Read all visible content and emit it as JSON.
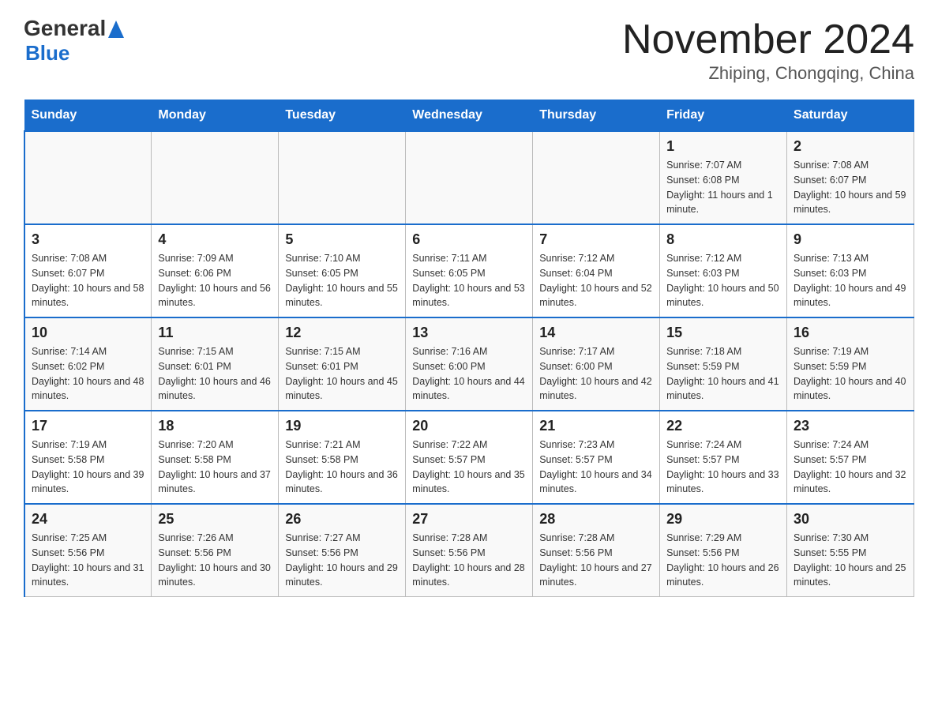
{
  "header": {
    "logo_line1": "General",
    "logo_line2": "Blue",
    "month_title": "November 2024",
    "location": "Zhiping, Chongqing, China"
  },
  "weekdays": [
    "Sunday",
    "Monday",
    "Tuesday",
    "Wednesday",
    "Thursday",
    "Friday",
    "Saturday"
  ],
  "weeks": [
    [
      {
        "day": "",
        "info": ""
      },
      {
        "day": "",
        "info": ""
      },
      {
        "day": "",
        "info": ""
      },
      {
        "day": "",
        "info": ""
      },
      {
        "day": "",
        "info": ""
      },
      {
        "day": "1",
        "info": "Sunrise: 7:07 AM\nSunset: 6:08 PM\nDaylight: 11 hours and 1 minute."
      },
      {
        "day": "2",
        "info": "Sunrise: 7:08 AM\nSunset: 6:07 PM\nDaylight: 10 hours and 59 minutes."
      }
    ],
    [
      {
        "day": "3",
        "info": "Sunrise: 7:08 AM\nSunset: 6:07 PM\nDaylight: 10 hours and 58 minutes."
      },
      {
        "day": "4",
        "info": "Sunrise: 7:09 AM\nSunset: 6:06 PM\nDaylight: 10 hours and 56 minutes."
      },
      {
        "day": "5",
        "info": "Sunrise: 7:10 AM\nSunset: 6:05 PM\nDaylight: 10 hours and 55 minutes."
      },
      {
        "day": "6",
        "info": "Sunrise: 7:11 AM\nSunset: 6:05 PM\nDaylight: 10 hours and 53 minutes."
      },
      {
        "day": "7",
        "info": "Sunrise: 7:12 AM\nSunset: 6:04 PM\nDaylight: 10 hours and 52 minutes."
      },
      {
        "day": "8",
        "info": "Sunrise: 7:12 AM\nSunset: 6:03 PM\nDaylight: 10 hours and 50 minutes."
      },
      {
        "day": "9",
        "info": "Sunrise: 7:13 AM\nSunset: 6:03 PM\nDaylight: 10 hours and 49 minutes."
      }
    ],
    [
      {
        "day": "10",
        "info": "Sunrise: 7:14 AM\nSunset: 6:02 PM\nDaylight: 10 hours and 48 minutes."
      },
      {
        "day": "11",
        "info": "Sunrise: 7:15 AM\nSunset: 6:01 PM\nDaylight: 10 hours and 46 minutes."
      },
      {
        "day": "12",
        "info": "Sunrise: 7:15 AM\nSunset: 6:01 PM\nDaylight: 10 hours and 45 minutes."
      },
      {
        "day": "13",
        "info": "Sunrise: 7:16 AM\nSunset: 6:00 PM\nDaylight: 10 hours and 44 minutes."
      },
      {
        "day": "14",
        "info": "Sunrise: 7:17 AM\nSunset: 6:00 PM\nDaylight: 10 hours and 42 minutes."
      },
      {
        "day": "15",
        "info": "Sunrise: 7:18 AM\nSunset: 5:59 PM\nDaylight: 10 hours and 41 minutes."
      },
      {
        "day": "16",
        "info": "Sunrise: 7:19 AM\nSunset: 5:59 PM\nDaylight: 10 hours and 40 minutes."
      }
    ],
    [
      {
        "day": "17",
        "info": "Sunrise: 7:19 AM\nSunset: 5:58 PM\nDaylight: 10 hours and 39 minutes."
      },
      {
        "day": "18",
        "info": "Sunrise: 7:20 AM\nSunset: 5:58 PM\nDaylight: 10 hours and 37 minutes."
      },
      {
        "day": "19",
        "info": "Sunrise: 7:21 AM\nSunset: 5:58 PM\nDaylight: 10 hours and 36 minutes."
      },
      {
        "day": "20",
        "info": "Sunrise: 7:22 AM\nSunset: 5:57 PM\nDaylight: 10 hours and 35 minutes."
      },
      {
        "day": "21",
        "info": "Sunrise: 7:23 AM\nSunset: 5:57 PM\nDaylight: 10 hours and 34 minutes."
      },
      {
        "day": "22",
        "info": "Sunrise: 7:24 AM\nSunset: 5:57 PM\nDaylight: 10 hours and 33 minutes."
      },
      {
        "day": "23",
        "info": "Sunrise: 7:24 AM\nSunset: 5:57 PM\nDaylight: 10 hours and 32 minutes."
      }
    ],
    [
      {
        "day": "24",
        "info": "Sunrise: 7:25 AM\nSunset: 5:56 PM\nDaylight: 10 hours and 31 minutes."
      },
      {
        "day": "25",
        "info": "Sunrise: 7:26 AM\nSunset: 5:56 PM\nDaylight: 10 hours and 30 minutes."
      },
      {
        "day": "26",
        "info": "Sunrise: 7:27 AM\nSunset: 5:56 PM\nDaylight: 10 hours and 29 minutes."
      },
      {
        "day": "27",
        "info": "Sunrise: 7:28 AM\nSunset: 5:56 PM\nDaylight: 10 hours and 28 minutes."
      },
      {
        "day": "28",
        "info": "Sunrise: 7:28 AM\nSunset: 5:56 PM\nDaylight: 10 hours and 27 minutes."
      },
      {
        "day": "29",
        "info": "Sunrise: 7:29 AM\nSunset: 5:56 PM\nDaylight: 10 hours and 26 minutes."
      },
      {
        "day": "30",
        "info": "Sunrise: 7:30 AM\nSunset: 5:55 PM\nDaylight: 10 hours and 25 minutes."
      }
    ]
  ]
}
